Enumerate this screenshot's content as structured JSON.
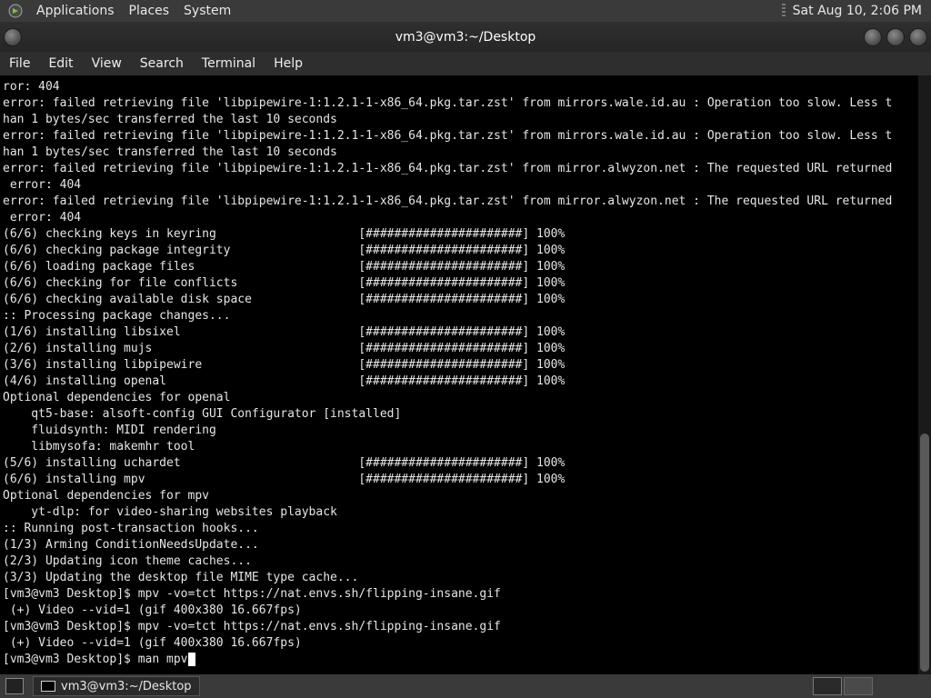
{
  "top_panel": {
    "menus": [
      "Applications",
      "Places",
      "System"
    ],
    "clock": "Sat Aug 10,  2:06 PM"
  },
  "window": {
    "title": "vm3@vm3:~/Desktop"
  },
  "menubar": [
    "File",
    "Edit",
    "View",
    "Search",
    "Terminal",
    "Help"
  ],
  "terminal": {
    "lines": [
      "ror: 404",
      "error: failed retrieving file 'libpipewire-1:1.2.1-1-x86_64.pkg.tar.zst' from mirrors.wale.id.au : Operation too slow. Less t",
      "han 1 bytes/sec transferred the last 10 seconds",
      "error: failed retrieving file 'libpipewire-1:1.2.1-1-x86_64.pkg.tar.zst' from mirrors.wale.id.au : Operation too slow. Less t",
      "han 1 bytes/sec transferred the last 10 seconds",
      "error: failed retrieving file 'libpipewire-1:1.2.1-1-x86_64.pkg.tar.zst' from mirror.alwyzon.net : The requested URL returned",
      " error: 404",
      "error: failed retrieving file 'libpipewire-1:1.2.1-1-x86_64.pkg.tar.zst' from mirror.alwyzon.net : The requested URL returned",
      " error: 404",
      "(6/6) checking keys in keyring                    [######################] 100%",
      "(6/6) checking package integrity                  [######################] 100%",
      "(6/6) loading package files                       [######################] 100%",
      "(6/6) checking for file conflicts                 [######################] 100%",
      "(6/6) checking available disk space               [######################] 100%",
      ":: Processing package changes...",
      "(1/6) installing libsixel                         [######################] 100%",
      "(2/6) installing mujs                             [######################] 100%",
      "(3/6) installing libpipewire                      [######################] 100%",
      "(4/6) installing openal                           [######################] 100%",
      "Optional dependencies for openal",
      "    qt5-base: alsoft-config GUI Configurator [installed]",
      "    fluidsynth: MIDI rendering",
      "    libmysofa: makemhr tool",
      "(5/6) installing uchardet                         [######################] 100%",
      "(6/6) installing mpv                              [######################] 100%",
      "Optional dependencies for mpv",
      "    yt-dlp: for video-sharing websites playback",
      ":: Running post-transaction hooks...",
      "(1/3) Arming ConditionNeedsUpdate...",
      "(2/3) Updating icon theme caches...",
      "(3/3) Updating the desktop file MIME type cache...",
      "[vm3@vm3 Desktop]$ mpv -vo=tct https://nat.envs.sh/flipping-insane.gif",
      " (+) Video --vid=1 (gif 400x380 16.667fps)",
      "[vm3@vm3 Desktop]$ mpv -vo=tct https://nat.envs.sh/flipping-insane.gif",
      " (+) Video --vid=1 (gif 400x380 16.667fps)"
    ],
    "prompt_line": "[vm3@vm3 Desktop]$ man mpv"
  },
  "taskbar": {
    "window_label": "vm3@vm3:~/Desktop"
  }
}
